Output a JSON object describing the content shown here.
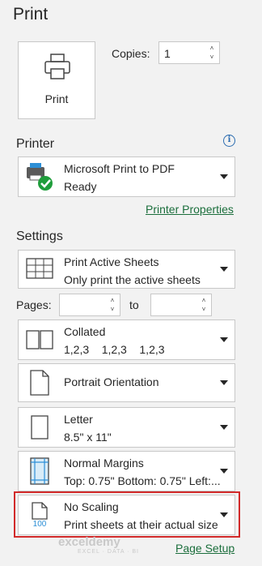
{
  "page": {
    "title": "Print"
  },
  "print_button": {
    "label": "Print"
  },
  "copies": {
    "label": "Copies:",
    "value": "1"
  },
  "printer": {
    "heading": "Printer",
    "name": "Microsoft Print to PDF",
    "status": "Ready",
    "properties_link": "Printer Properties"
  },
  "settings": {
    "heading": "Settings",
    "active_sheets": {
      "title": "Print Active Sheets",
      "subtitle": "Only print the active sheets"
    },
    "pages": {
      "label": "Pages:",
      "to_label": "to"
    },
    "collated": {
      "title": "Collated",
      "subtitle": "1,2,3    1,2,3    1,2,3"
    },
    "orientation": {
      "title": "Portrait Orientation"
    },
    "paper": {
      "title": "Letter",
      "subtitle": "8.5\" x 11\""
    },
    "margins": {
      "title": "Normal Margins",
      "subtitle": "Top: 0.75\" Bottom: 0.75\" Left:..."
    },
    "scaling": {
      "title": "No Scaling",
      "subtitle": "Print sheets at their actual size",
      "icon_text": "100"
    },
    "page_setup_link": "Page Setup"
  },
  "watermark": {
    "brand": "exceldemy",
    "tagline": "EXCEL · DATA · BI"
  },
  "colors": {
    "accent_link": "#1b6e3c",
    "highlight": "#d22a2a",
    "info": "#2b6cb0"
  }
}
